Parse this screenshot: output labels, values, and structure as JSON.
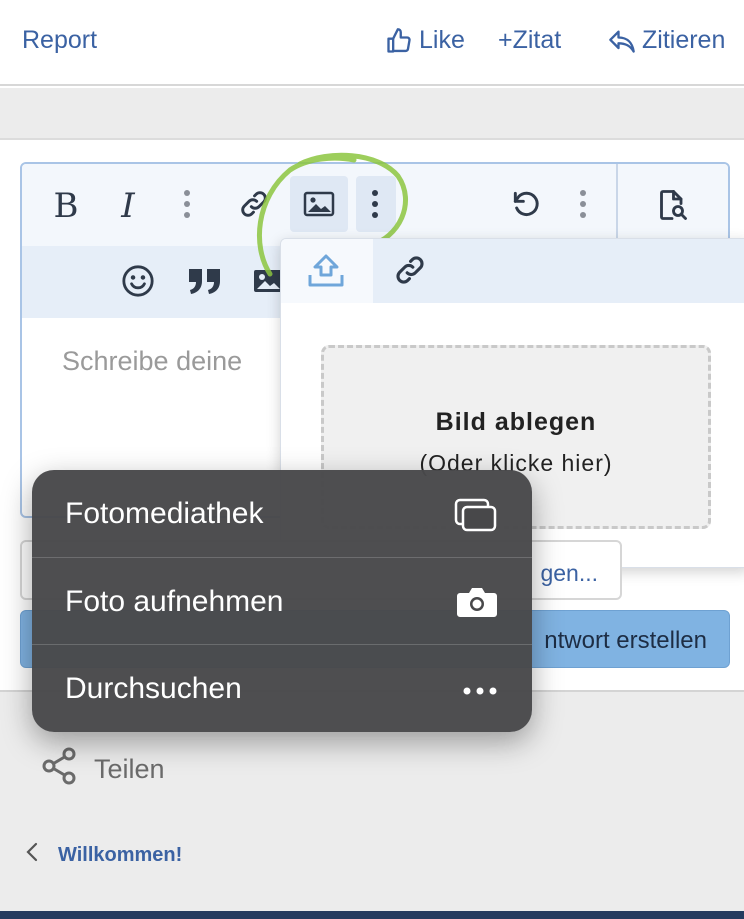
{
  "top_bar": {
    "report_label": "Report",
    "like_label": "Like",
    "zitat_label": "+Zitat",
    "zitieren_label": "Zitieren"
  },
  "editor": {
    "bold_label": "B",
    "italic_label": "I",
    "placeholder": "Schreibe deine",
    "toolbar_icons": [
      "bold-icon",
      "italic-icon",
      "more-vertical-icon",
      "link-icon",
      "image-icon",
      "more-vertical-icon",
      "undo-icon",
      "more-vertical-icon",
      "preview-icon"
    ],
    "toolbar2_icons": [
      "smiley-icon",
      "quote-icon",
      "image-icon"
    ]
  },
  "image_popup": {
    "tabs": [
      "upload-icon",
      "link-icon"
    ],
    "drop_title": "Bild ablegen",
    "drop_subtitle": "(Oder klicke hier)"
  },
  "buttons": {
    "attach_label": "gen...",
    "reply_label": "ntwort erstellen"
  },
  "ios_menu": {
    "items": [
      {
        "label": "Fotomediathek",
        "icon": "photo-library-icon"
      },
      {
        "label": "Foto aufnehmen",
        "icon": "camera-icon"
      },
      {
        "label": "Durchsuchen",
        "icon": "ellipsis-icon"
      }
    ]
  },
  "footer": {
    "share_label": "Teilen",
    "breadcrumb_label": "Willkommen!"
  },
  "colors": {
    "link_blue": "#3b62a3",
    "toolbar_bg": "#f3f7fc",
    "reply_button": "#80b3e2",
    "highlight_circle": "#8cc63f",
    "ios_menu_bg": "#48484a"
  }
}
